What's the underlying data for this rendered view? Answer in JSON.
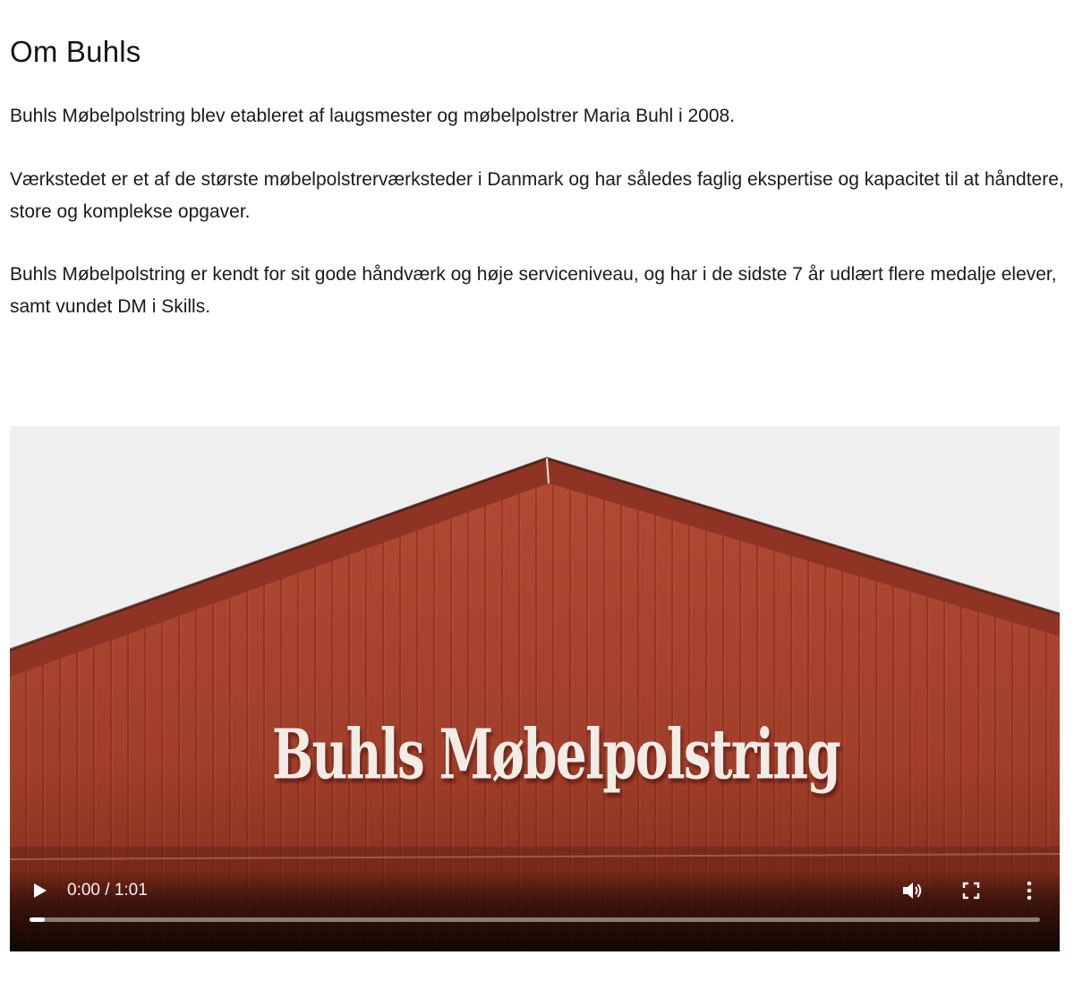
{
  "page": {
    "title": "Om Buhls",
    "paragraphs": [
      "Buhls Møbelpolstring blev etableret af laugsmester og møbelpolstrer Maria Buhl i 2008.",
      "Værkstedet er et af de største møbelpolstrerværksteder i Danmark og har således faglig ekspertise og kapacitet til at håndtere, store og komplekse opgaver.",
      "Buhls Møbelpolstring er kendt for sit gode håndværk og høje serviceniveau, og har i de sidste 7 år udlært flere medalje elever, samt vundet DM i Skills."
    ]
  },
  "video": {
    "sign_text": "Buhls Møbelpolstring",
    "time_display": "0:00 / 1:01",
    "progress_fraction": 0.015,
    "icons": {
      "play": "play-icon",
      "volume": "volume-icon",
      "fullscreen": "fullscreen-icon",
      "menu": "more-vertical-icon"
    },
    "colors": {
      "barn_wall": "#a8442e",
      "roof_trim": "#8a3022",
      "sky": "#efefef",
      "lettering": "#f1ece6"
    }
  }
}
